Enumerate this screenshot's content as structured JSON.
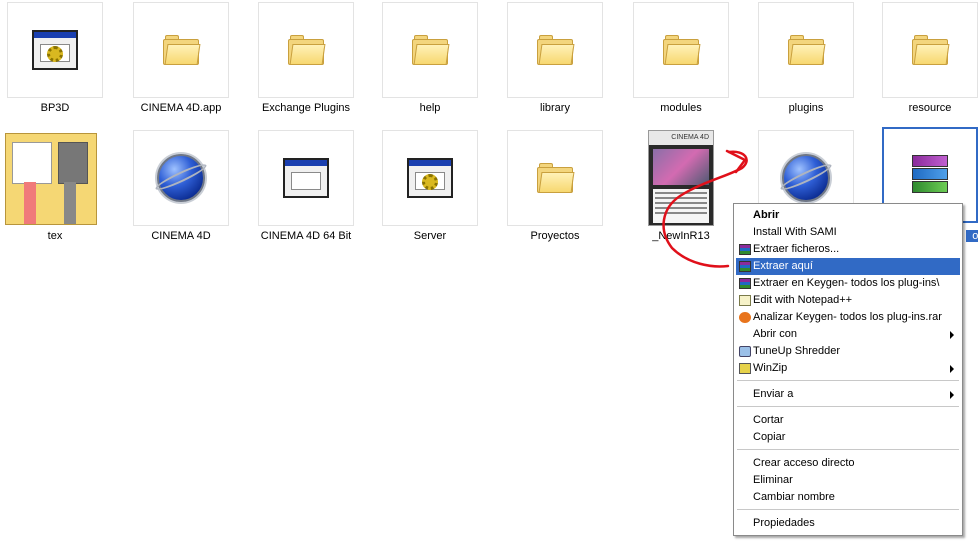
{
  "files_row1": [
    {
      "label": "BP3D",
      "icon": "installer-gear-window-icon"
    },
    {
      "label": "CINEMA 4D.app",
      "icon": "folder-icon"
    },
    {
      "label": "Exchange Plugins",
      "icon": "folder-icon"
    },
    {
      "label": "help",
      "icon": "folder-icon"
    },
    {
      "label": "library",
      "icon": "folder-icon"
    },
    {
      "label": "modules",
      "icon": "folder-icon"
    },
    {
      "label": "plugins",
      "icon": "folder-icon"
    },
    {
      "label": "resource",
      "icon": "folder-icon"
    }
  ],
  "files_row2": [
    {
      "label": "tex",
      "icon": "texture-folder-icon"
    },
    {
      "label": "CINEMA 4D",
      "icon": "cinema4d-globe-icon"
    },
    {
      "label": "CINEMA 4D 64 Bit",
      "icon": "application-window-icon"
    },
    {
      "label": "Server",
      "icon": "installer-gear-window-icon"
    },
    {
      "label": "Proyectos",
      "icon": "folder-icon"
    },
    {
      "label": "_NewInR13",
      "icon": "image-thumbnail-icon"
    },
    {
      "label": "",
      "icon": "cinema4d-globe-icon"
    },
    {
      "label": "os",
      "icon": "winrar-archive-icon",
      "selected": true
    }
  ],
  "context_menu": {
    "items": [
      {
        "label": "Abrir",
        "bold": true
      },
      {
        "label": "Install With SAMI"
      },
      {
        "label": "Extraer ficheros...",
        "icon": "winrar-icon"
      },
      {
        "label": "Extraer aquí",
        "icon": "winrar-icon",
        "highlighted": true
      },
      {
        "label": "Extraer en Keygen- todos los plug-ins\\",
        "icon": "winrar-icon"
      },
      {
        "label": "Edit with Notepad++",
        "icon": "notepad-icon"
      },
      {
        "label": "Analizar Keygen- todos los plug-ins.rar",
        "icon": "antivirus-icon"
      },
      {
        "label": "Abrir con",
        "submenu": true
      },
      {
        "label": "TuneUp Shredder",
        "icon": "shredder-icon"
      },
      {
        "label": "WinZip",
        "icon": "winzip-icon",
        "submenu": true
      },
      {
        "label": "Enviar a",
        "submenu": true
      },
      {
        "label": "Cortar"
      },
      {
        "label": "Copiar"
      },
      {
        "label": "Crear acceso directo"
      },
      {
        "label": "Eliminar"
      },
      {
        "label": "Cambiar nombre"
      },
      {
        "label": "Propiedades"
      }
    ]
  },
  "thumbnail_brand": "CINEMA 4D",
  "colors": {
    "selection": "#316ac5",
    "annotation": "#e0101a"
  }
}
